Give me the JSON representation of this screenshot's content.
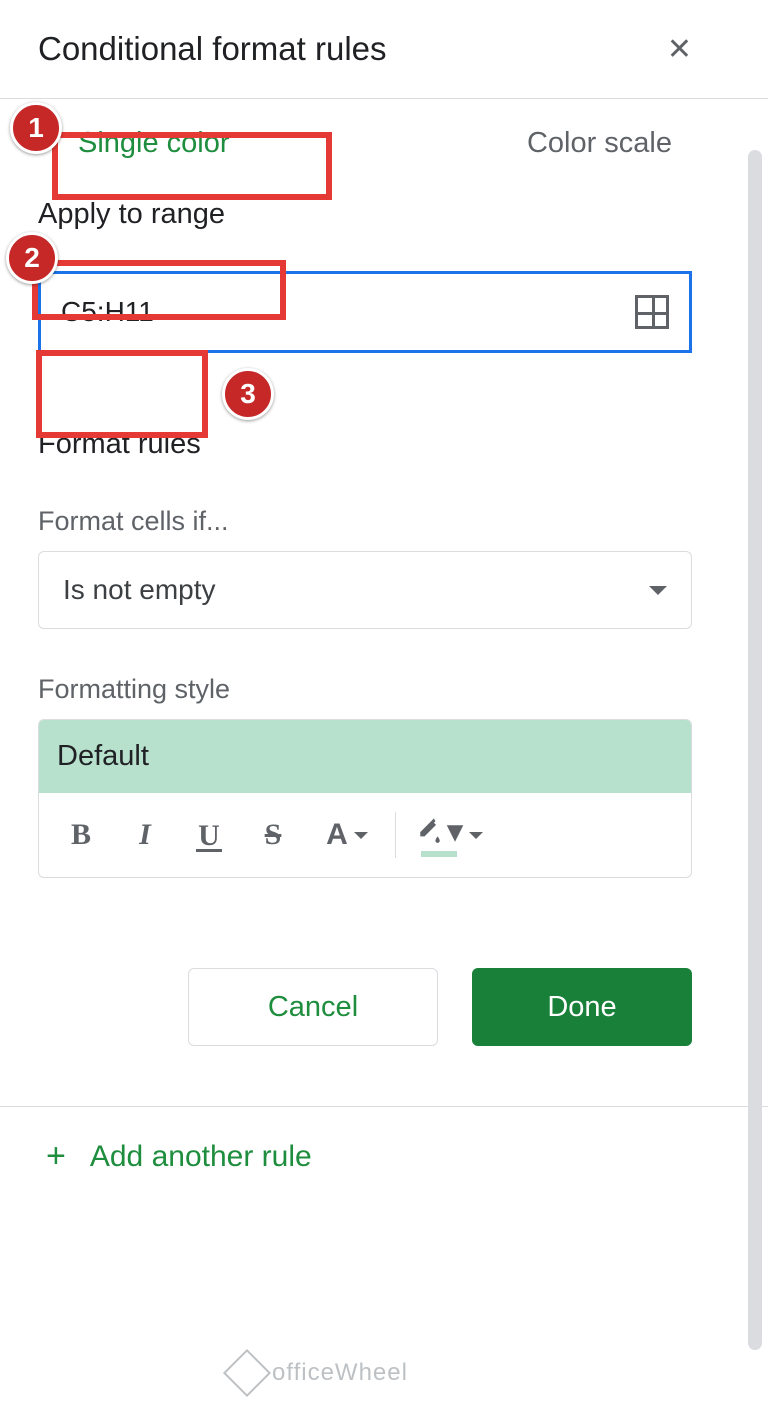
{
  "header": {
    "title": "Conditional format rules"
  },
  "tabs": {
    "single_color": "Single color",
    "color_scale": "Color scale"
  },
  "range": {
    "label": "Apply to range",
    "value": "C5:H11"
  },
  "format_rules": {
    "title": "Format rules",
    "cells_if_label": "Format cells if...",
    "cells_if_value": "Is not empty",
    "style_label": "Formatting style",
    "style_preview": "Default"
  },
  "buttons": {
    "cancel": "Cancel",
    "done": "Done"
  },
  "add_rule": "Add another rule",
  "callouts": {
    "c1": "1",
    "c2": "2",
    "c3": "3"
  },
  "watermark": "officeWheel"
}
